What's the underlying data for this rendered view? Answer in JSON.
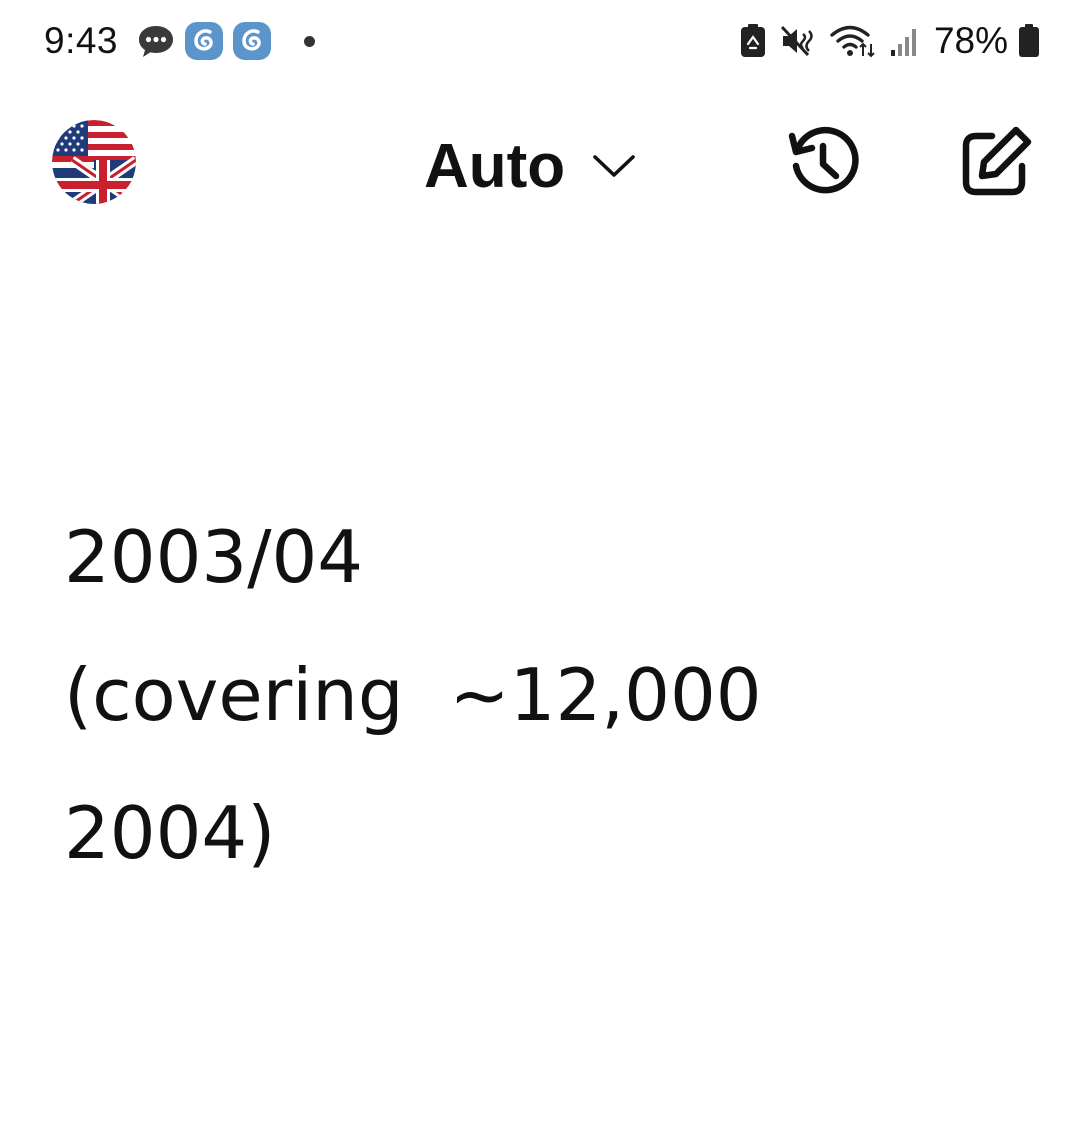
{
  "status_bar": {
    "time": "9:43",
    "battery_percent": "78%",
    "icons": [
      "chat-bubble-icon",
      "app-swirl-icon",
      "app-swirl-icon",
      "notification-dot",
      "battery-saver-icon",
      "mute-icon",
      "wifi-icon",
      "signal-icon",
      "battery-icon"
    ]
  },
  "app_bar": {
    "language_flag": "us-uk-flag-icon",
    "mode_label": "Auto",
    "icons": [
      "chevron-down-icon",
      "history-icon",
      "edit-icon"
    ]
  },
  "content": {
    "line1": "2003/04",
    "line2": "(covering  ~12,000",
    "line3": "2004)"
  },
  "colors": {
    "text": "#111111",
    "background": "#ffffff",
    "swirl_icon_bg": "#5b95c9"
  }
}
